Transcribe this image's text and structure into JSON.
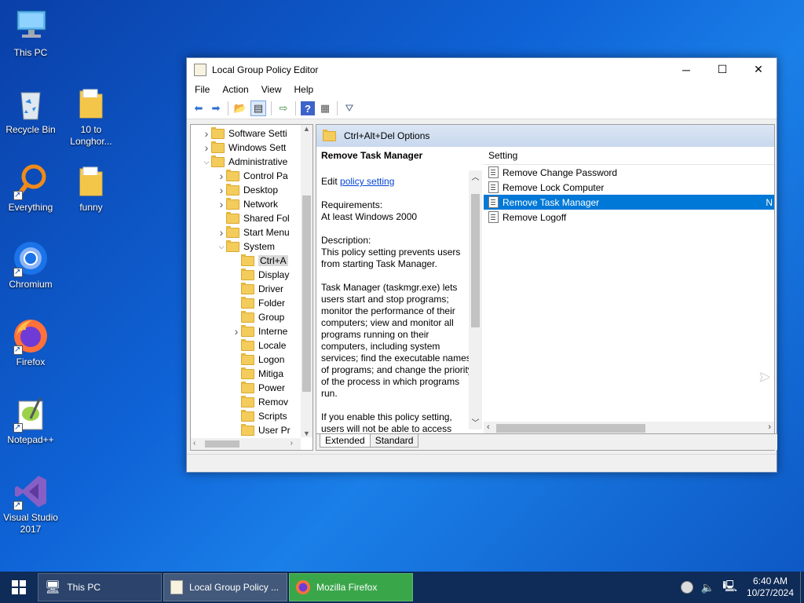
{
  "desktop": {
    "icons": [
      {
        "label": "This PC",
        "icon": "computer-icon"
      },
      {
        "label": "Recycle Bin",
        "icon": "recycle-bin-icon"
      },
      {
        "label": "10 to Longhor...",
        "icon": "folder-icon"
      },
      {
        "label": "Everything",
        "icon": "search-magnifier-icon"
      },
      {
        "label": "funny",
        "icon": "folder-icon"
      },
      {
        "label": "Chromium",
        "icon": "chromium-icon"
      },
      {
        "label": "Firefox",
        "icon": "firefox-icon"
      },
      {
        "label": "Notepad++",
        "icon": "notepadpp-icon"
      },
      {
        "label": "Visual Studio 2017",
        "icon": "visual-studio-icon"
      }
    ]
  },
  "window": {
    "title": "Local Group Policy Editor",
    "controls": {
      "minimize": "─",
      "maximize": "☐",
      "close": "✕"
    },
    "menu": [
      "File",
      "Action",
      "View",
      "Help"
    ],
    "tree": [
      {
        "label": "Software Setti",
        "indent": 1,
        "arrow": "right"
      },
      {
        "label": "Windows Sett",
        "indent": 1,
        "arrow": "right"
      },
      {
        "label": "Administrative",
        "indent": 1,
        "arrow": "down"
      },
      {
        "label": "Control Pa",
        "indent": 2,
        "arrow": "right"
      },
      {
        "label": "Desktop",
        "indent": 2,
        "arrow": "right"
      },
      {
        "label": "Network",
        "indent": 2,
        "arrow": "right"
      },
      {
        "label": "Shared Fol",
        "indent": 2,
        "arrow": ""
      },
      {
        "label": "Start Menu",
        "indent": 2,
        "arrow": "right"
      },
      {
        "label": "System",
        "indent": 2,
        "arrow": "down"
      },
      {
        "label": "Ctrl+A",
        "indent": 3,
        "arrow": "",
        "selected": true
      },
      {
        "label": "Display",
        "indent": 3,
        "arrow": ""
      },
      {
        "label": "Driver",
        "indent": 3,
        "arrow": ""
      },
      {
        "label": "Folder",
        "indent": 3,
        "arrow": ""
      },
      {
        "label": "Group",
        "indent": 3,
        "arrow": ""
      },
      {
        "label": "Interne",
        "indent": 3,
        "arrow": "right"
      },
      {
        "label": "Locale",
        "indent": 3,
        "arrow": ""
      },
      {
        "label": "Logon",
        "indent": 3,
        "arrow": ""
      },
      {
        "label": "Mitiga",
        "indent": 3,
        "arrow": ""
      },
      {
        "label": "Power",
        "indent": 3,
        "arrow": ""
      },
      {
        "label": "Remov",
        "indent": 3,
        "arrow": ""
      },
      {
        "label": "Scripts",
        "indent": 3,
        "arrow": ""
      },
      {
        "label": "User Pr",
        "indent": 3,
        "arrow": ""
      }
    ],
    "right_header": "Ctrl+Alt+Del Options",
    "description": {
      "heading": "Remove Task Manager",
      "edit_prefix": "Edit",
      "edit_link": "policy setting",
      "requirements_label": "Requirements:",
      "requirements": "At least Windows 2000",
      "description_label": "Description:",
      "description": "This policy setting prevents users from starting Task Manager.",
      "details": "Task Manager (taskmgr.exe) lets users start and stop programs; monitor the performance of their computers; view and monitor all programs running on their computers, including system services; find the executable names of programs; and change the priority of the process in which programs run.",
      "enable": "If you enable this policy setting, users will not be able to access"
    },
    "list": {
      "column": "Setting",
      "items": [
        {
          "label": "Remove Change Password",
          "state": ""
        },
        {
          "label": "Remove Lock Computer",
          "state": ""
        },
        {
          "label": "Remove Task Manager",
          "state": "N",
          "selected": true
        },
        {
          "label": "Remove Logoff",
          "state": ""
        }
      ]
    },
    "tabs": [
      "Extended",
      "Standard"
    ]
  },
  "taskbar": {
    "tasks": [
      {
        "label": "This PC",
        "icon": "computer-icon"
      },
      {
        "label": "Local Group Policy ...",
        "icon": "policy-editor-icon"
      },
      {
        "label": "Mozilla Firefox",
        "icon": "firefox-icon"
      }
    ],
    "time": "6:40 AM",
    "date": "10/27/2024"
  },
  "colors": {
    "selection": "#0078d7",
    "firefox_task": "#3aa64a"
  }
}
